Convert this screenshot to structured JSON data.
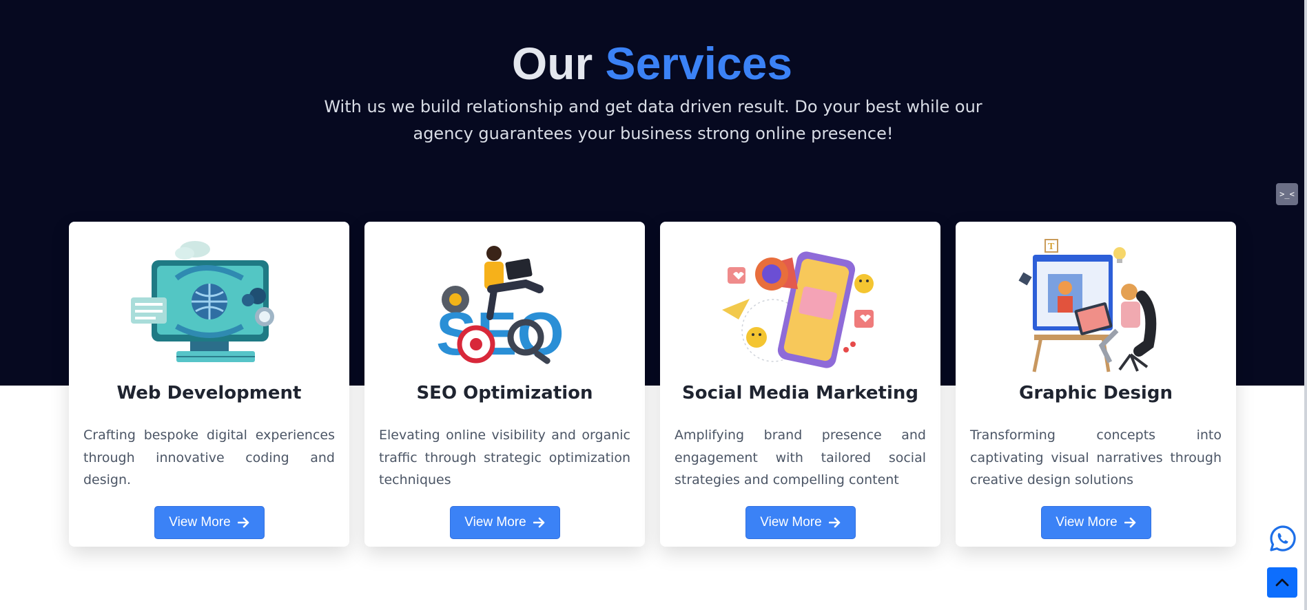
{
  "section": {
    "title_part1": "Our",
    "title_part2": "Services",
    "subtitle": "With us we build relationship and get data driven result. Do your best while our agency guarantees your business strong online presence!"
  },
  "dev_toggle_label": ">_<",
  "cards": [
    {
      "title": "Web Development",
      "description": "Crafting bespoke digital experiences through innovative coding and design.",
      "button_label": "View More",
      "icon": "web-development-illustration"
    },
    {
      "title": "SEO Optimization",
      "description": "Elevating online visibility and organic traffic through strategic optimization techniques",
      "button_label": "View More",
      "icon": "seo-illustration"
    },
    {
      "title": "Social Media Marketing",
      "description": "Amplifying brand presence and engagement with tailored social strategies and compelling content",
      "button_label": "View More",
      "icon": "social-media-illustration"
    },
    {
      "title": "Graphic Design",
      "description": "Transforming concepts into captivating visual narratives through creative design solutions",
      "button_label": "View More",
      "icon": "graphic-design-illustration"
    }
  ],
  "floating": {
    "whatsapp_icon": "whatsapp-icon",
    "back_to_top_icon": "chevron-up-icon"
  },
  "colors": {
    "hero_bg": "#060920",
    "accent": "#3b82f6",
    "whatsapp": "#0d6efd"
  }
}
